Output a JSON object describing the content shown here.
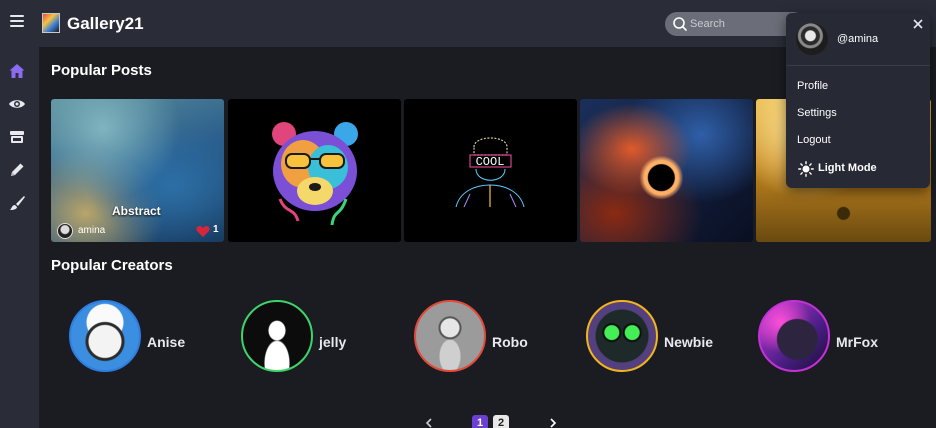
{
  "header": {
    "app_title": "Gallery21",
    "search_placeholder": "Search",
    "search_value": ""
  },
  "sidebar": {
    "items": [
      {
        "icon": "home-icon",
        "active": true
      },
      {
        "icon": "eye-icon",
        "active": false
      },
      {
        "icon": "store-icon",
        "active": false
      },
      {
        "icon": "pencil-icon",
        "active": false
      },
      {
        "icon": "brush-icon",
        "active": false
      }
    ]
  },
  "popular_posts": {
    "title": "Popular Posts",
    "posts": [
      {
        "caption": "Abstract",
        "user": "amina",
        "likes": "1"
      },
      {
        "caption": "",
        "user": "",
        "likes": ""
      },
      {
        "caption": "",
        "user": "",
        "likes": ""
      },
      {
        "caption": "",
        "user": "",
        "likes": ""
      },
      {
        "caption": "",
        "user": "",
        "likes": ""
      }
    ],
    "post3_text": "COOL"
  },
  "popular_creators": {
    "title": "Popular Creators",
    "creators": [
      {
        "name": "Anise",
        "ring": "#2f7de1"
      },
      {
        "name": "jelly",
        "ring": "#3fd46a"
      },
      {
        "name": "Robo",
        "ring": "#e24b3b"
      },
      {
        "name": "Newbie",
        "ring": "#f2b51c"
      },
      {
        "name": "MrFox",
        "ring": "#c531d8"
      }
    ]
  },
  "pagination": {
    "prev": "‹",
    "next": "›",
    "pages": [
      "1",
      "2"
    ],
    "current": "1"
  },
  "user_menu": {
    "handle": "@amina",
    "close": "✕",
    "items": [
      "Profile",
      "Settings",
      "Logout"
    ],
    "mode_toggle": "Light Mode"
  },
  "colors": {
    "background": "#1b1c21",
    "panel": "#2a2c37",
    "accent": "#6a3fd1",
    "active_icon": "#8b6cf0"
  }
}
